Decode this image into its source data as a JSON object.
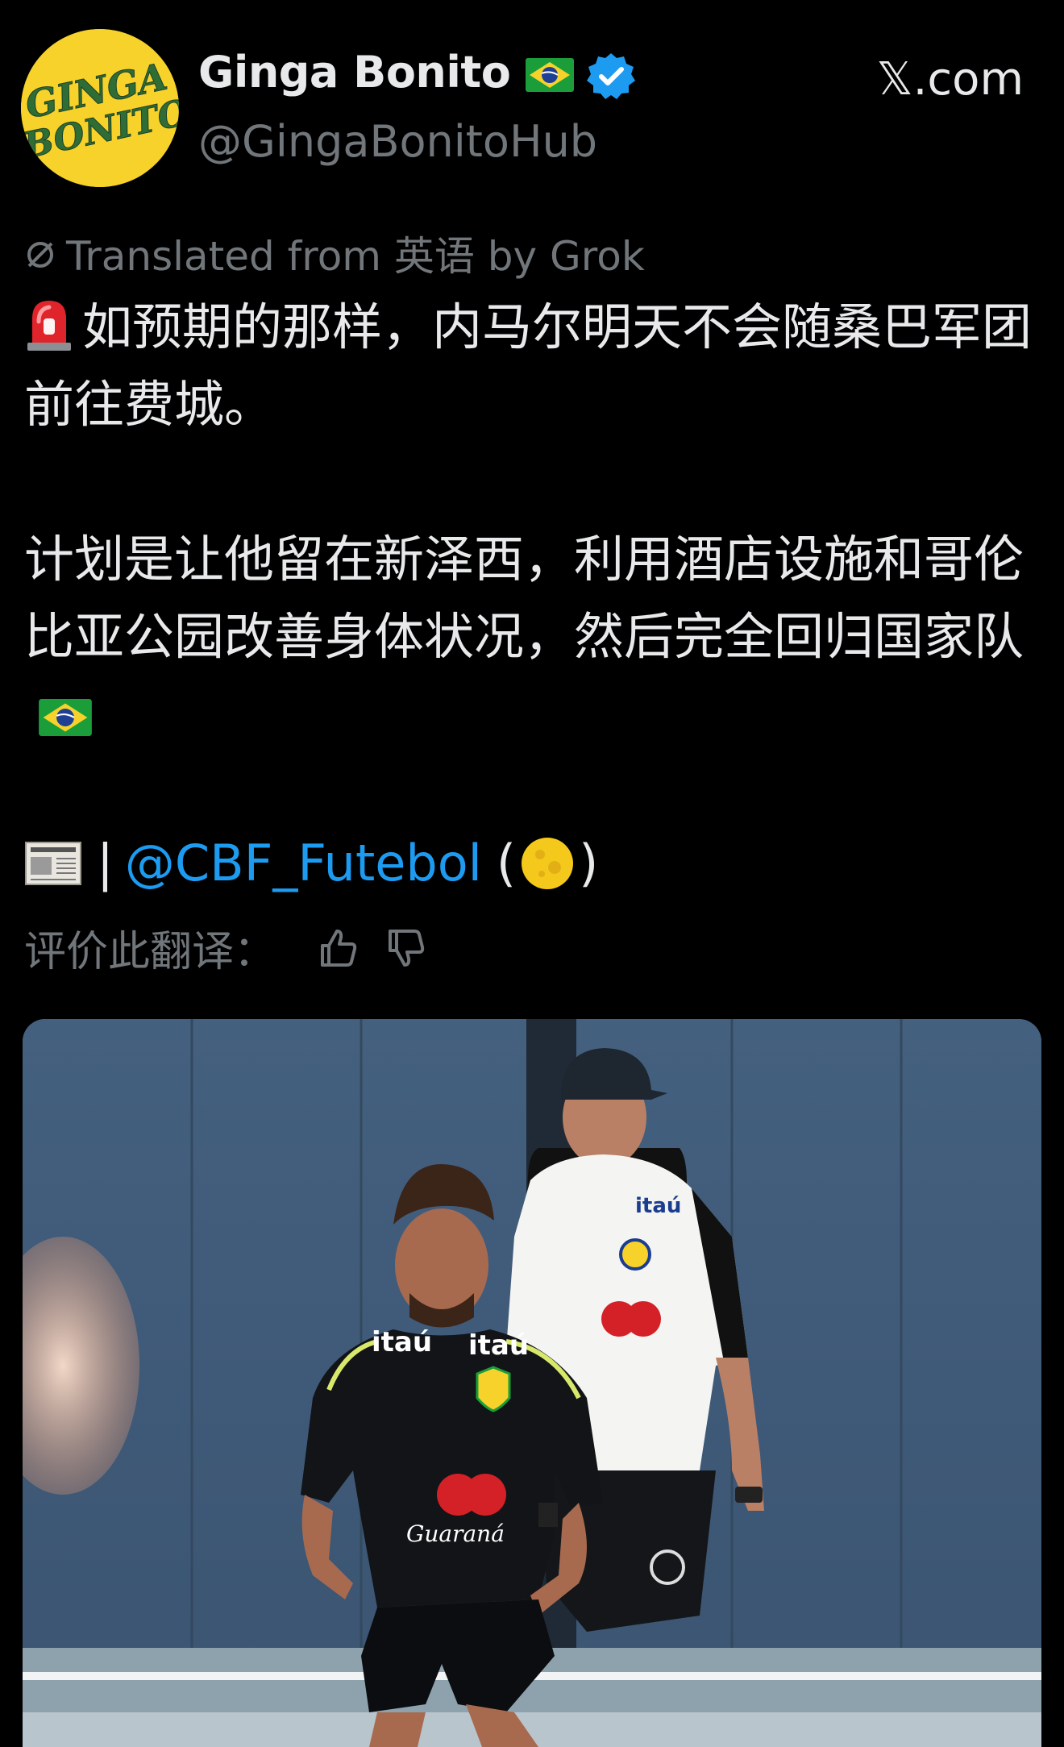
{
  "header": {
    "display_name": "Ginga Bonito",
    "handle": "@GingaBonitoHub",
    "site": "𝕏.com",
    "avatar_text_line1": "GINGA",
    "avatar_text_line2": "BONITO",
    "flag_icon": "brazil-flag-icon",
    "verified_icon": "verified-badge-icon",
    "verified_color": "#1d9bf0"
  },
  "translation": {
    "notice": "Translated from 英语 by Grok",
    "icon": "translate-off-icon"
  },
  "tweet": {
    "para1": "如预期的那样，内马尔明天不会随桑巴军团前往费城。",
    "para1_icon": "siren-icon",
    "para2": "计划是让他留在新泽西，利用酒店设施和哥伦比亚公园改善身体状况，然后完全回归国家队",
    "para2_icon": "brazil-flag-icon",
    "source_icon": "newspaper-icon",
    "source_pipe": "|",
    "mention": "@CBF_Futebol",
    "paren_open": "(",
    "paren_close": ")",
    "paren_icon": "full-moon-icon"
  },
  "rate": {
    "label": "评价此翻译：",
    "thumbs_up_icon": "thumbs-up-icon",
    "thumbs_down_icon": "thumbs-down-icon"
  },
  "media": {
    "jersey_sponsor_1": "itaú",
    "jersey_sponsor_2": "itaú",
    "jersey_brand": "Guaraná",
    "coach_sponsor": "itaú"
  },
  "colors": {
    "background": "#000000",
    "text": "#e7e9ea",
    "muted": "#71767b",
    "link": "#1d9bf0"
  }
}
